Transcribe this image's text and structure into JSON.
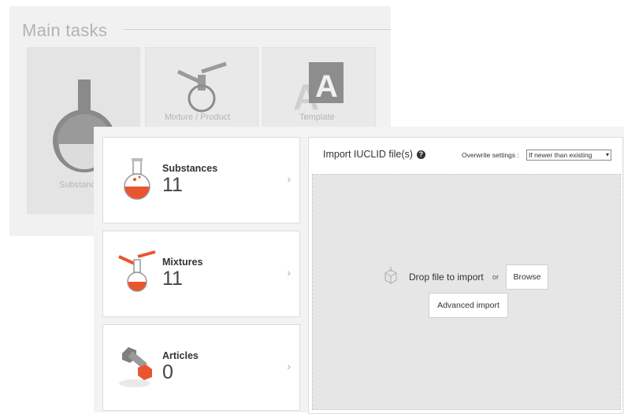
{
  "background": {
    "title": "Main tasks",
    "tiles": [
      {
        "label": "Substances"
      },
      {
        "label": "Mixture / Product"
      },
      {
        "label": "Template"
      }
    ]
  },
  "cards": [
    {
      "name": "Substances",
      "count": "11",
      "icon": "flask-icon"
    },
    {
      "name": "Mixtures",
      "count": "11",
      "icon": "mixture-flask-icon"
    },
    {
      "name": "Articles",
      "count": "0",
      "icon": "bolt-nut-icon"
    }
  ],
  "import": {
    "title": "Import IUCLID file(s)",
    "overwrite_label": "Overwrite settings :",
    "overwrite_value": "If newer than existing",
    "drop_text": "Drop file to import",
    "or_text": "or",
    "browse_label": "Browse",
    "advanced_label": "Advanced import"
  },
  "colors": {
    "accent": "#e8562f",
    "panel_bg": "#f3f3f3",
    "drop_bg": "#e6e6e6"
  }
}
